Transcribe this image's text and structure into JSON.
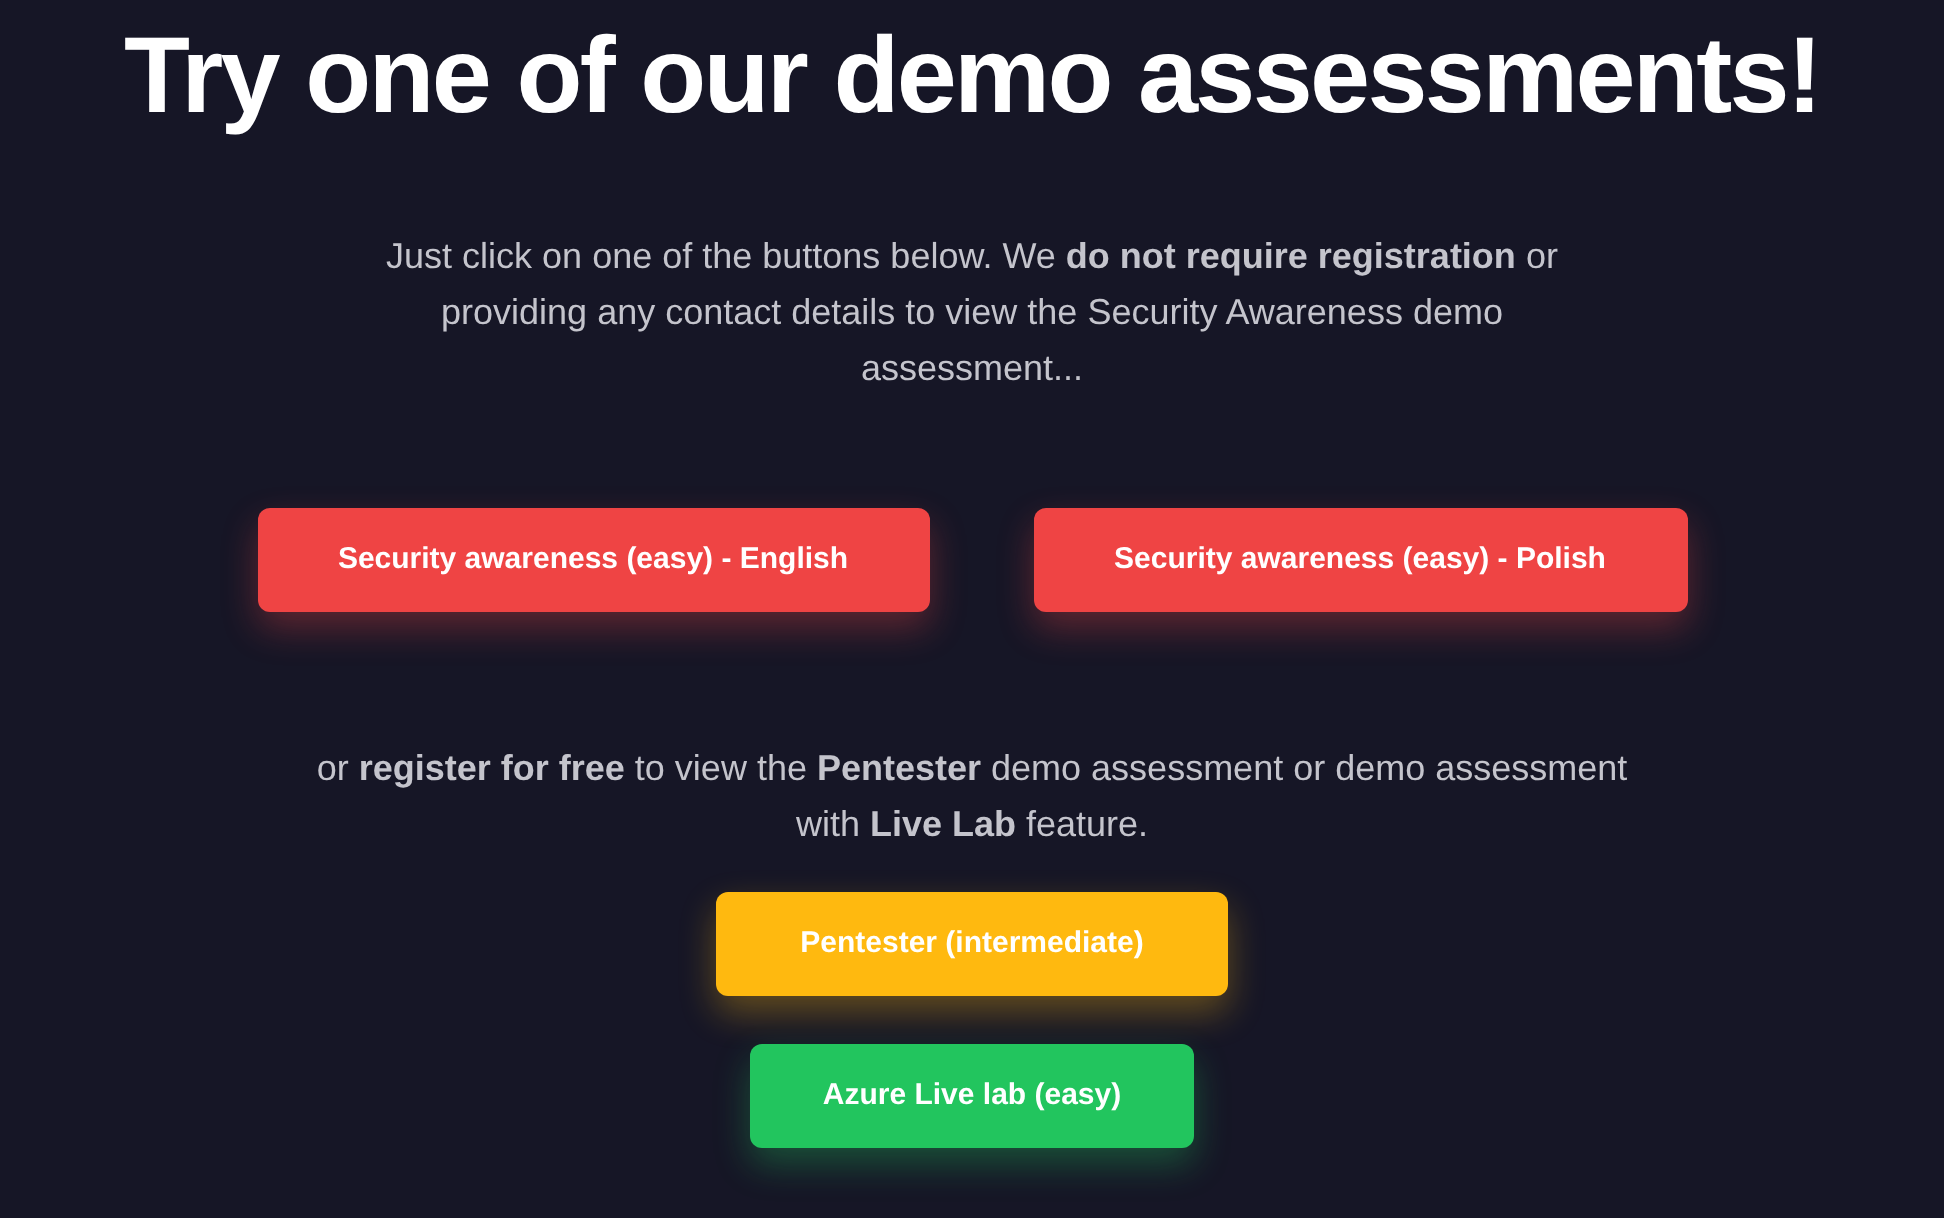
{
  "title": "Try one of our demo assessments!",
  "intro": "Just click on one of the buttons below. We **do not require registration** or providing any contact details to view the Security Awareness demo assessment...",
  "free_buttons": [
    {
      "label": "Security awareness (easy) - English",
      "color": "#ef4444"
    },
    {
      "label": "Security awareness (easy) - Polish",
      "color": "#ef4444"
    }
  ],
  "register_text": "or **register for free** to view the **Pentester** demo assessment or demo assessment with **Live Lab** feature.",
  "register_buttons": [
    {
      "label": "Pentester (intermediate)",
      "color": "#ffb90f"
    },
    {
      "label": "Azure Live lab (easy)",
      "color": "#22c55e"
    }
  ]
}
